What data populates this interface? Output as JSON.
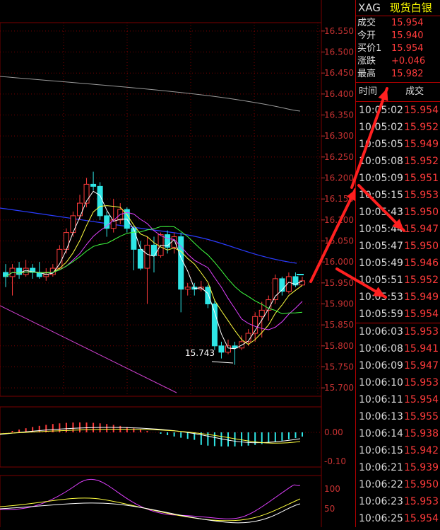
{
  "ticker": {
    "code": "XAG",
    "name": "现货白银"
  },
  "quotes": [
    {
      "label": "成交",
      "value": "15.954"
    },
    {
      "label": "今开",
      "value": "15.940"
    },
    {
      "label": "买价1",
      "value": "15.954"
    },
    {
      "label": "涨跌",
      "value": "+0.046"
    },
    {
      "label": "最高",
      "value": "15.982"
    }
  ],
  "trades_header": {
    "time": "时间",
    "price": "成交"
  },
  "trades": [
    {
      "time": "10:05:02",
      "price": "15.954"
    },
    {
      "time": "10:05:02",
      "price": "15.952"
    },
    {
      "time": "10:05:05",
      "price": "15.949"
    },
    {
      "time": "10:05:08",
      "price": "15.952"
    },
    {
      "time": "10:05:09",
      "price": "15.951"
    },
    {
      "time": "10:05:15",
      "price": "15.953"
    },
    {
      "time": "10:05:43",
      "price": "15.950"
    },
    {
      "time": "10:05:44",
      "price": "15.947"
    },
    {
      "time": "10:05:47",
      "price": "15.950"
    },
    {
      "time": "10:05:49",
      "price": "15.946"
    },
    {
      "time": "10:05:51",
      "price": "15.952"
    },
    {
      "time": "10:05:53",
      "price": "15.949"
    },
    {
      "time": "10:05:59",
      "price": "15.954"
    },
    {
      "time": "10:06:03",
      "price": "15.953"
    },
    {
      "time": "10:06:08",
      "price": "15.941"
    },
    {
      "time": "10:06:09",
      "price": "15.947"
    },
    {
      "time": "10:06:10",
      "price": "15.953"
    },
    {
      "time": "10:06:11",
      "price": "15.954"
    },
    {
      "time": "10:06:13",
      "price": "15.955"
    },
    {
      "time": "10:06:14",
      "price": "15.938"
    },
    {
      "time": "10:06:15",
      "price": "15.942"
    },
    {
      "time": "10:06:21",
      "price": "15.939"
    },
    {
      "time": "10:06:22",
      "price": "15.950"
    },
    {
      "time": "10:06:23",
      "price": "15.953"
    },
    {
      "time": "10:06:25",
      "price": "15.954"
    }
  ],
  "colors": {
    "up": "#ff3b3b",
    "down": "#2ee6e6",
    "grid": "#7a0000",
    "axis": "#c83232"
  },
  "chart_data": {
    "type": "candlestick",
    "price_axis": {
      "ticks": [
        "16.550",
        "16.500",
        "16.450",
        "16.400",
        "16.350",
        "16.300",
        "16.250",
        "16.200",
        "16.150",
        "16.100",
        "16.050",
        "16.000",
        "15.950",
        "15.900",
        "15.850",
        "15.800",
        "15.750",
        "15.700"
      ],
      "ylim": [
        15.68,
        16.57
      ]
    },
    "annotation": "15.743",
    "candles": [
      [
        15.975,
        15.965,
        15.995,
        15.94
      ],
      [
        15.965,
        15.985,
        15.995,
        15.92
      ],
      [
        15.985,
        15.97,
        16.0,
        15.96
      ],
      [
        15.97,
        15.985,
        16.005,
        15.965
      ],
      [
        15.985,
        15.975,
        15.995,
        15.96
      ],
      [
        15.975,
        15.965,
        16.0,
        15.96
      ],
      [
        15.965,
        15.97,
        15.985,
        15.955
      ],
      [
        15.97,
        15.985,
        15.995,
        15.965
      ],
      [
        15.985,
        16.03,
        16.04,
        15.98
      ],
      [
        16.03,
        16.07,
        16.08,
        16.02
      ],
      [
        16.07,
        16.11,
        16.12,
        16.06
      ],
      [
        16.11,
        16.14,
        16.16,
        16.1
      ],
      [
        16.14,
        16.185,
        16.2,
        16.13
      ],
      [
        16.185,
        16.18,
        16.215,
        16.17
      ],
      [
        16.18,
        16.11,
        16.19,
        16.1
      ],
      [
        16.11,
        16.08,
        16.12,
        16.06
      ],
      [
        16.08,
        16.1,
        16.15,
        16.07
      ],
      [
        16.1,
        16.125,
        16.14,
        16.09
      ],
      [
        16.125,
        16.08,
        16.13,
        16.07
      ],
      [
        16.08,
        16.03,
        16.085,
        15.98
      ],
      [
        16.03,
        15.985,
        16.05,
        15.98
      ],
      [
        15.985,
        16.04,
        16.06,
        15.9
      ],
      [
        16.04,
        16.015,
        16.06,
        15.975
      ],
      [
        16.015,
        16.065,
        16.07,
        16.01
      ],
      [
        16.065,
        16.035,
        16.075,
        16.02
      ],
      [
        16.035,
        16.06,
        16.07,
        16.02
      ],
      [
        16.06,
        15.935,
        16.07,
        15.88
      ],
      [
        15.935,
        15.94,
        15.95,
        15.92
      ],
      [
        15.94,
        15.935,
        15.95,
        15.92
      ],
      [
        15.935,
        15.94,
        15.955,
        15.93
      ],
      [
        15.94,
        15.9,
        15.945,
        15.89
      ],
      [
        15.9,
        15.8,
        15.91,
        15.79
      ],
      [
        15.8,
        15.785,
        15.81,
        15.77
      ],
      [
        15.785,
        15.8,
        15.815,
        15.78
      ],
      [
        15.8,
        15.795,
        15.81,
        15.755
      ],
      [
        15.795,
        15.81,
        15.825,
        15.79
      ],
      [
        15.81,
        15.83,
        15.84,
        15.8
      ],
      [
        15.83,
        15.87,
        15.88,
        15.81
      ],
      [
        15.87,
        15.885,
        15.905,
        15.82
      ],
      [
        15.885,
        15.91,
        15.92,
        15.86
      ],
      [
        15.91,
        15.96,
        15.97,
        15.9
      ],
      [
        15.96,
        15.93,
        15.965,
        15.92
      ],
      [
        15.93,
        15.965,
        15.975,
        15.925
      ],
      [
        15.965,
        15.945,
        15.975,
        15.94
      ],
      [
        15.945,
        15.955,
        15.965,
        15.945
      ]
    ],
    "macd": {
      "ticks": [
        "0.00",
        "-0.10"
      ]
    },
    "kd": {
      "ticks": [
        "100",
        "50"
      ]
    }
  }
}
